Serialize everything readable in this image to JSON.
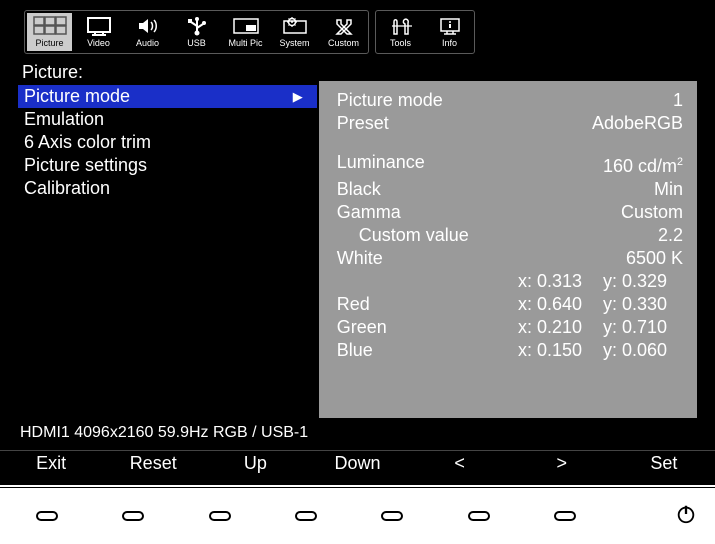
{
  "tabs_main": [
    {
      "id": "picture",
      "label": "Picture",
      "active": true,
      "icon": "picture-icon"
    },
    {
      "id": "video",
      "label": "Video",
      "active": false,
      "icon": "video-icon"
    },
    {
      "id": "audio",
      "label": "Audio",
      "active": false,
      "icon": "audio-icon"
    },
    {
      "id": "usb",
      "label": "USB",
      "active": false,
      "icon": "usb-icon"
    },
    {
      "id": "multipic",
      "label": "Multi Pic",
      "active": false,
      "icon": "multipic-icon"
    },
    {
      "id": "system",
      "label": "System",
      "active": false,
      "icon": "system-icon"
    },
    {
      "id": "custom",
      "label": "Custom",
      "active": false,
      "icon": "custom-icon"
    }
  ],
  "tabs_extra": [
    {
      "id": "tools",
      "label": "Tools",
      "active": false,
      "icon": "tools-icon"
    },
    {
      "id": "info",
      "label": "Info",
      "active": false,
      "icon": "info-icon"
    }
  ],
  "section_title": "Picture:",
  "menu_items": [
    {
      "id": "picture-mode",
      "label": "Picture mode",
      "selected": true
    },
    {
      "id": "emulation",
      "label": "Emulation",
      "selected": false
    },
    {
      "id": "six-axis",
      "label": "6 Axis color trim",
      "selected": false
    },
    {
      "id": "picture-settings",
      "label": "Picture settings",
      "selected": false
    },
    {
      "id": "calibration",
      "label": "Calibration",
      "selected": false
    }
  ],
  "details": {
    "picture_mode": {
      "label": "Picture mode",
      "value": "1"
    },
    "preset": {
      "label": "Preset",
      "value": "AdobeRGB"
    },
    "luminance": {
      "label": "Luminance",
      "value": "160 cd/m",
      "unit_sup": "2"
    },
    "black": {
      "label": "Black",
      "value": "Min"
    },
    "gamma": {
      "label": "Gamma",
      "value": "Custom"
    },
    "gamma_custom": {
      "label": "Custom value",
      "value": "2.2"
    },
    "white": {
      "label": "White",
      "value": "6500  K"
    },
    "white_xy": {
      "x_label": "x: 0.313",
      "y_label": "y: 0.329"
    },
    "red": {
      "label": "Red",
      "x_label": "x: 0.640",
      "y_label": "y: 0.330"
    },
    "green": {
      "label": "Green",
      "x_label": "x: 0.210",
      "y_label": "y: 0.710"
    },
    "blue": {
      "label": "Blue",
      "x_label": "x: 0.150",
      "y_label": "y: 0.060"
    }
  },
  "status_text": "HDMI1 4096x2160 59.9Hz RGB / USB-1",
  "softkeys": [
    {
      "id": "exit",
      "label": "Exit"
    },
    {
      "id": "reset",
      "label": "Reset"
    },
    {
      "id": "up",
      "label": "Up"
    },
    {
      "id": "down",
      "label": "Down"
    },
    {
      "id": "prev",
      "label": "<"
    },
    {
      "id": "next",
      "label": ">"
    },
    {
      "id": "set",
      "label": "Set"
    }
  ]
}
